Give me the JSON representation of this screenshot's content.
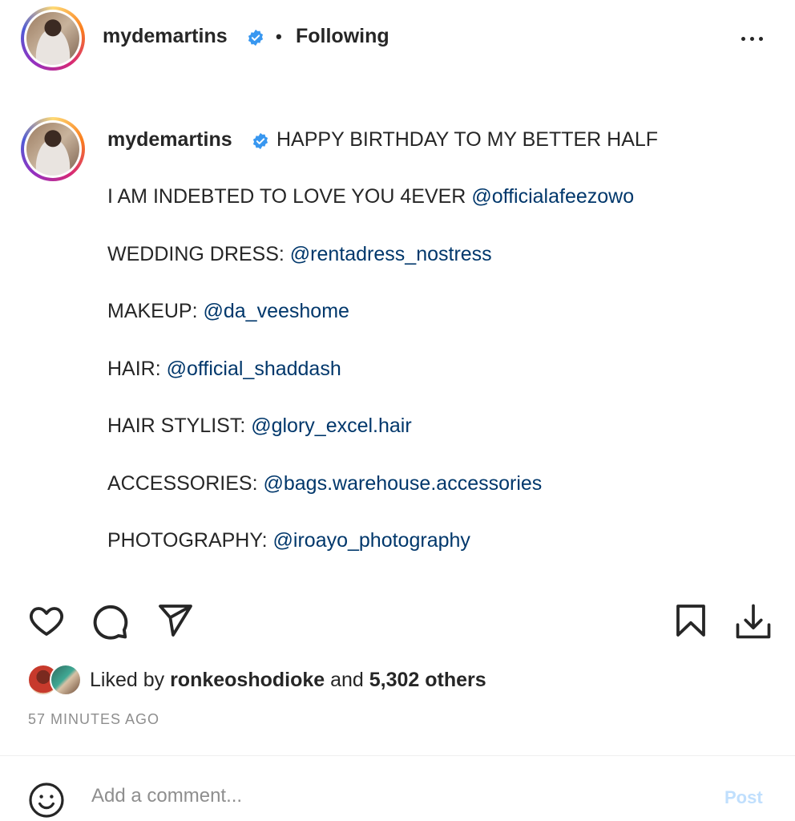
{
  "header": {
    "username": "mydemartins",
    "separator": "•",
    "follow_status": "Following"
  },
  "caption": {
    "username": "mydemartins",
    "lines": [
      {
        "text": "HAPPY BIRTHDAY TO MY BETTER HALF",
        "mention": ""
      },
      {
        "text": "I AM INDEBTED TO LOVE YOU 4EVER ",
        "mention": "@officialafeezowo"
      },
      {
        "text": "WEDDING DRESS: ",
        "mention": "@rentadress_nostress"
      },
      {
        "text": "MAKEUP: ",
        "mention": "@da_veeshome"
      },
      {
        "text": "HAIR: ",
        "mention": "@official_shaddash"
      },
      {
        "text": "HAIR STYLIST: ",
        "mention": "@glory_excel.hair"
      },
      {
        "text": "ACCESSORIES: ",
        "mention": "@bags.warehouse.accessories"
      },
      {
        "text": "PHOTOGRAPHY: ",
        "mention": "@iroayo_photography"
      }
    ]
  },
  "actions": {
    "icons": [
      "heart-icon",
      "comment-icon",
      "share-icon",
      "bookmark-icon",
      "download-icon"
    ]
  },
  "likes": {
    "prefix": "Liked by ",
    "user": "ronkeoshodioke",
    "conjunction": " and ",
    "count": "5,302 others"
  },
  "timestamp": "57 MINUTES AGO",
  "comment": {
    "placeholder": "Add a comment...",
    "post_label": "Post"
  },
  "colors": {
    "text": "#262626",
    "mention": "#00376b",
    "verified": "#3897f0",
    "muted": "#8e8e8e",
    "post_disabled": "#c0dffd"
  }
}
